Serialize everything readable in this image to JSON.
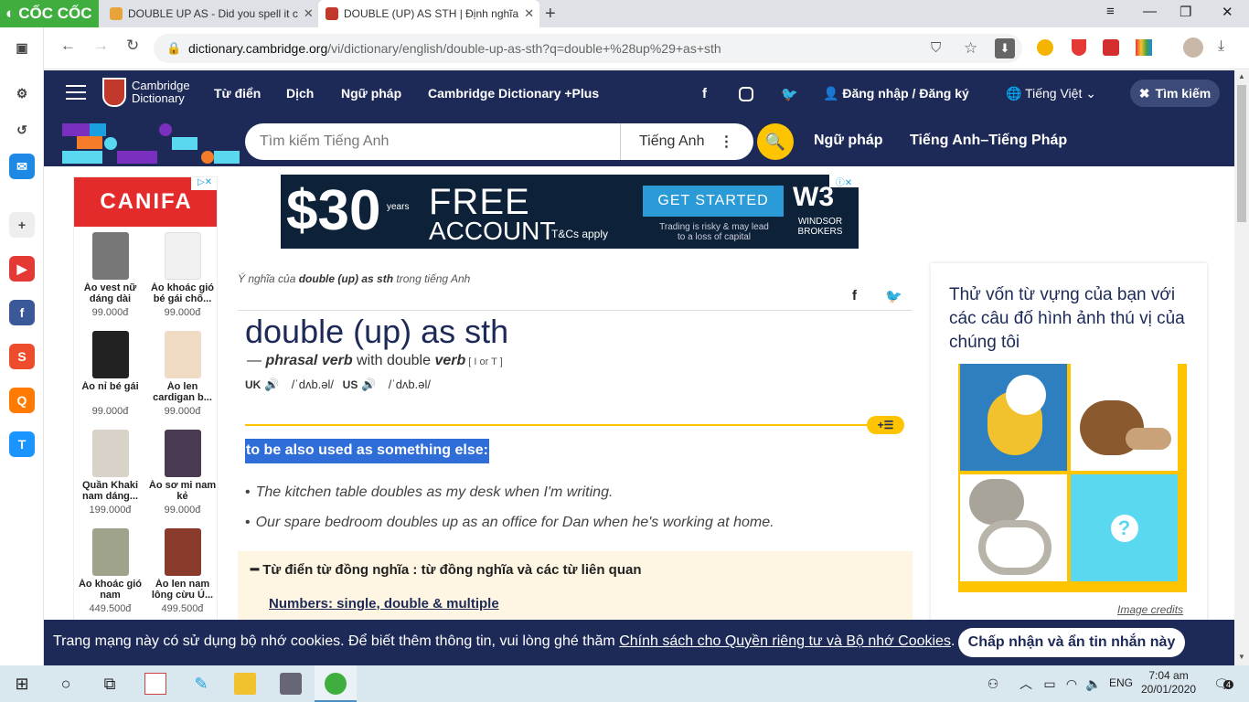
{
  "browser": {
    "brand": "CỐC CỐC",
    "tabs": [
      {
        "title": "DOUBLE UP AS - Did you spell it c",
        "active": false
      },
      {
        "title": "DOUBLE (UP) AS STH | Định nghĩa",
        "active": true
      }
    ],
    "url_host": "dictionary.cambridge.org",
    "url_path": "/vi/dictionary/english/double-up-as-sth?q=double+%28up%29+as+sth"
  },
  "header": {
    "logo": "Cambridge Dictionary",
    "nav": [
      "Từ điển",
      "Dịch",
      "Ngữ pháp",
      "Cambridge Dictionary +Plus"
    ],
    "login": "Đăng nhập / Đăng ký",
    "language": "Tiếng Việt",
    "search_button": "Tìm kiếm"
  },
  "search": {
    "placeholder": "Tìm kiếm Tiếng Anh",
    "dictionary": "Tiếng Anh",
    "links": [
      "Ngữ pháp",
      "Tiếng Anh–Tiếng Pháp"
    ]
  },
  "left_ad": {
    "brand": "CANIFA",
    "products": [
      {
        "name": "Áo vest nữ dáng dài",
        "price": "99.000đ"
      },
      {
        "name": "Áo khoác gió bé gái chố...",
        "price": "99.000đ"
      },
      {
        "name": "Áo nỉ bé gái",
        "price": "99.000đ"
      },
      {
        "name": "Áo len cardigan b...",
        "price": "99.000đ"
      },
      {
        "name": "Quần Khaki nam dáng...",
        "price": "199.000đ"
      },
      {
        "name": "Áo sơ mi nam kẻ",
        "price": "99.000đ"
      },
      {
        "name": "Áo khoác gió nam",
        "price": "449.500đ"
      },
      {
        "name": "Áo len nam lông cừu Ú...",
        "price": "499.500đ"
      }
    ]
  },
  "banner": {
    "amount": "$30",
    "years": "years",
    "free": "FREE",
    "account": "ACCOUNT",
    "tcs": "T&Cs apply",
    "cta": "GET STARTED",
    "risk": "Trading is risky & may lead to a loss of capital",
    "logo": "W3",
    "logo_sub": "WINDSOR BROKERS"
  },
  "entry": {
    "breadcrumb_pre": "Ý nghĩa của ",
    "breadcrumb_term": "double (up) as sth",
    "breadcrumb_post": " trong tiếng Anh",
    "headword": "double (up) as sth",
    "pos_prefix": "— ",
    "pos": "phrasal verb",
    "pos_with": " with double ",
    "pos_verb": "verb",
    "grammar": " [ I or T ]",
    "uk_label": "UK",
    "uk_ipa": "/ˈdʌb.əl/",
    "us_label": "US",
    "us_ipa": "/ˈdʌb.əl/",
    "definition": "to be also used as something else:",
    "examples": [
      "The kitchen table doubles as my desk when I'm writing.",
      "Our spare bedroom doubles up as an office for Dan when he's working at home."
    ],
    "thesaurus_title": "Từ điển từ đồng nghĩa : từ đồng nghĩa và các từ liên quan",
    "thesaurus_link": "Numbers: single, double & multiple"
  },
  "quiz": {
    "title": "Thử vốn từ vựng của bạn với các câu đố hình ảnh thú vị của chúng tôi",
    "credits": "Image credits"
  },
  "cookie": {
    "text": "Trang mạng này có sử dụng bộ nhớ cookies. Để biết thêm thông tin, vui lòng ghé thăm ",
    "link": "Chính sách cho Quyền riêng tư và Bộ nhớ Cookies",
    "end": ".",
    "button": "Chấp nhận và ẩn tin nhắn này"
  },
  "taskbar": {
    "lang": "ENG",
    "time": "7:04 am",
    "date": "20/01/2020",
    "notifications": "4"
  },
  "colors": {
    "navy": "#1d2a57",
    "yellow": "#fec400",
    "highlight": "#2f6dd8"
  }
}
